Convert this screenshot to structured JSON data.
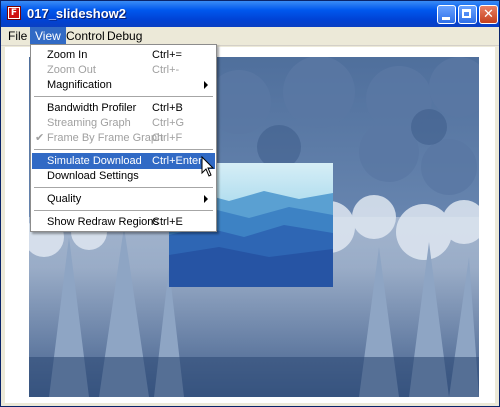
{
  "window": {
    "title": "017_slideshow2",
    "app_icon_glyph": "F",
    "buttons": {
      "minimize": "minimize-icon",
      "maximize": "maximize-icon",
      "close": "close-icon"
    }
  },
  "menubar": {
    "items": [
      {
        "label": "File"
      },
      {
        "label": "View",
        "active": true
      },
      {
        "label": "Control"
      },
      {
        "label": "Debug"
      }
    ]
  },
  "view_menu": {
    "items": [
      {
        "label": "Zoom In",
        "shortcut": "Ctrl+=",
        "enabled": true
      },
      {
        "label": "Zoom Out",
        "shortcut": "Ctrl+-",
        "enabled": false
      },
      {
        "label": "Magnification",
        "submenu": true,
        "enabled": true
      },
      {
        "label": "Bandwidth Profiler",
        "shortcut": "Ctrl+B",
        "enabled": true
      },
      {
        "label": "Streaming Graph",
        "shortcut": "Ctrl+G",
        "enabled": false
      },
      {
        "label": "Frame By Frame Graph",
        "shortcut": "Ctrl+F",
        "enabled": false,
        "checked": true
      },
      {
        "label": "Simulate Download",
        "shortcut": "Ctrl+Enter",
        "enabled": true,
        "highlighted": true
      },
      {
        "label": "Download Settings",
        "enabled": true
      },
      {
        "label": "Quality",
        "submenu": true,
        "enabled": true
      },
      {
        "label": "Show Redraw Regions",
        "shortcut": "Ctrl+E",
        "enabled": true
      }
    ],
    "check_glyph": "✔"
  },
  "stage": {
    "background_image": "snowy-forest-photo",
    "inset_image": "blue-mountains-photo"
  },
  "colors": {
    "titlebar": "#0058ee",
    "menu_highlight": "#316ac5",
    "disabled_text": "#a0a0a0"
  }
}
